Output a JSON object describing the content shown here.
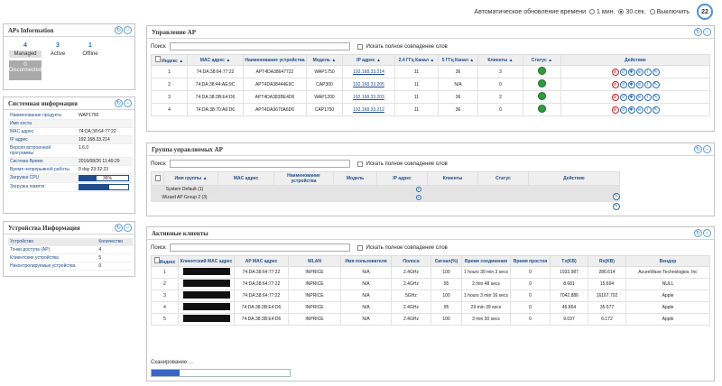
{
  "topbar": {
    "auto_refresh_label": "Автоматическое обновление времени",
    "opt1": "1 мин.",
    "opt2": "30 сек.",
    "opt3": "Выключить",
    "counter": "22"
  },
  "aps_info": {
    "title": "APs Information",
    "managed_count": "4",
    "managed_label": "Managed",
    "active_count": "3",
    "active_label": "Active",
    "offline_count": "1",
    "offline_label": "Offline",
    "disconnected_count": "0",
    "disconnected_label": "Disconnected"
  },
  "sysinfo": {
    "title": "Системная информация",
    "rows": [
      {
        "k": "Наименование продукта",
        "v": "WAP1750"
      },
      {
        "k": "Имя хоста",
        "v": ""
      },
      {
        "k": "MAC адрес",
        "v": "74:DA:38:64:77:22"
      },
      {
        "k": "IP адрес",
        "v": "192.168.33.214"
      },
      {
        "k": "Версия встроенной программы",
        "v": "1.6.0"
      },
      {
        "k": "Система Время",
        "v": "2016/08/26 11:49:29"
      },
      {
        "k": "Время непрерывной работы",
        "v": "0 day 23:32:23"
      }
    ],
    "cpu_label": "Загрузка CPU",
    "cpu_value": "36%",
    "cpu_fraction": 0.36,
    "mem_label": "Загрузка памяти",
    "mem_value": "61%",
    "mem_fraction": 0.61
  },
  "devinfo": {
    "title": "Устройства Информация",
    "h_device": "Устройство",
    "h_count": "Количество",
    "rows": [
      {
        "k": "Точки доступа (AP)",
        "v": "4"
      },
      {
        "k": "Клиентские устройства",
        "v": "5"
      },
      {
        "k": "Неконтролируемые устройства",
        "v": "0"
      }
    ]
  },
  "manage_ap": {
    "title": "Управление AP",
    "search_label": "Поиск",
    "search_value": "",
    "fullmatch_label": "Искать полное совпадение слов",
    "headers": [
      "Индекс",
      "MAC адрес",
      "Наименование устройства",
      "Модель",
      "IP адрес",
      "2.4 ГГц Канал",
      "5 ГГц Канал",
      "Клиенты",
      "Статус",
      "Действие"
    ],
    "rows": [
      {
        "idx": "1",
        "mac": "74:DA:38:64:77:22",
        "name": "APT4DA38647722",
        "model": "WAP1750",
        "ip": "192.168.33.214",
        "ch24": "11",
        "ch5": "36",
        "clients": "3"
      },
      {
        "idx": "2",
        "mac": "74:DA:38:44:AE:9C",
        "name": "APT4DA38444E9C",
        "model": "CAP300",
        "ip": "192.168.33.205",
        "ch24": "11",
        "ch5": "N/A",
        "clients": "0"
      },
      {
        "idx": "3",
        "mac": "74:DA:38:3B:E4:D6",
        "name": "APT4DA383BE4D6",
        "model": "WAP1200",
        "ip": "192.168.33.203",
        "ch24": "11",
        "ch5": "36",
        "clients": "2"
      },
      {
        "idx": "4",
        "mac": "74:DA:38:70:A6:D6",
        "name": "APT4DA3670A6D6",
        "model": "CAP1750",
        "ip": "192.168.33.212",
        "ch24": "11",
        "ch5": "36",
        "clients": "0"
      }
    ]
  },
  "group_ap": {
    "title": "Группа управляемых AP",
    "search_label": "Поиск",
    "fullmatch_label": "Искать полное совпадение слов",
    "headers": [
      "Имя группы",
      "MAC адрес",
      "Наименование устройства",
      "Модель",
      "IP адрес",
      "Клиенты",
      "Статус",
      "Действие"
    ],
    "groups": [
      "System Default (1)",
      "Wizard AP Group 2 (3)"
    ]
  },
  "clients": {
    "title": "Активные клиенты",
    "search_label": "Поиск",
    "fullmatch_label": "Искать полное совпадение слов",
    "headers": [
      "Индекс",
      "Клиентский MAC адрес",
      "AP MAC адрес",
      "WLAN",
      "Имя пользователя",
      "Полоса",
      "Сигнал(%)",
      "Время соединения",
      "Время простоя",
      "Tx(KB)",
      "Rx(KB)",
      "Вендор"
    ],
    "rows": [
      {
        "idx": "1",
        "ap": "74:DA:38:64:77:22",
        "wlan": "INPRICE",
        "user": "N/A",
        "band": "2.4GHz",
        "sig": "100",
        "conn": "1 hours 39 min 3 secs",
        "idle": "0",
        "tx": "1933.987",
        "rx": "286.614",
        "vendor": "AzureWave Technologies, Inc"
      },
      {
        "idx": "2",
        "ap": "74:DA:38:64:77:22",
        "wlan": "INPRICE",
        "user": "N/A",
        "band": "2.4GHz",
        "sig": "95",
        "conn": "2 min 48 secs",
        "idle": "0",
        "tx": "8.681",
        "rx": "15.694",
        "vendor": "NULL"
      },
      {
        "idx": "3",
        "ap": "74:DA:38:64:77:22",
        "wlan": "INPRICE",
        "user": "N/A",
        "band": "5GHz",
        "sig": "100",
        "conn": "1 hours 3 min 16 secs",
        "idle": "0",
        "tx": "7042.886",
        "rx": "16167.702",
        "vendor": "Apple"
      },
      {
        "idx": "4",
        "ap": "74:DA:38:3B:E4:D6",
        "wlan": "INPRICE",
        "user": "N/A",
        "band": "2.4GHz",
        "sig": "95",
        "conn": "29 min 39 secs",
        "idle": "0",
        "tx": "46.864",
        "rx": "35.577",
        "vendor": "Apple"
      },
      {
        "idx": "5",
        "ap": "74:DA:38:3B:E4:D6",
        "wlan": "INPRICE",
        "user": "N/A",
        "band": "2.4GHz",
        "sig": "100",
        "conn": "3 min 30 secs",
        "idle": "0",
        "tx": "9.037",
        "rx": "6.172",
        "vendor": "Apple"
      }
    ],
    "scan_label": "Сканирование ...",
    "scan_fraction": 0.2
  }
}
